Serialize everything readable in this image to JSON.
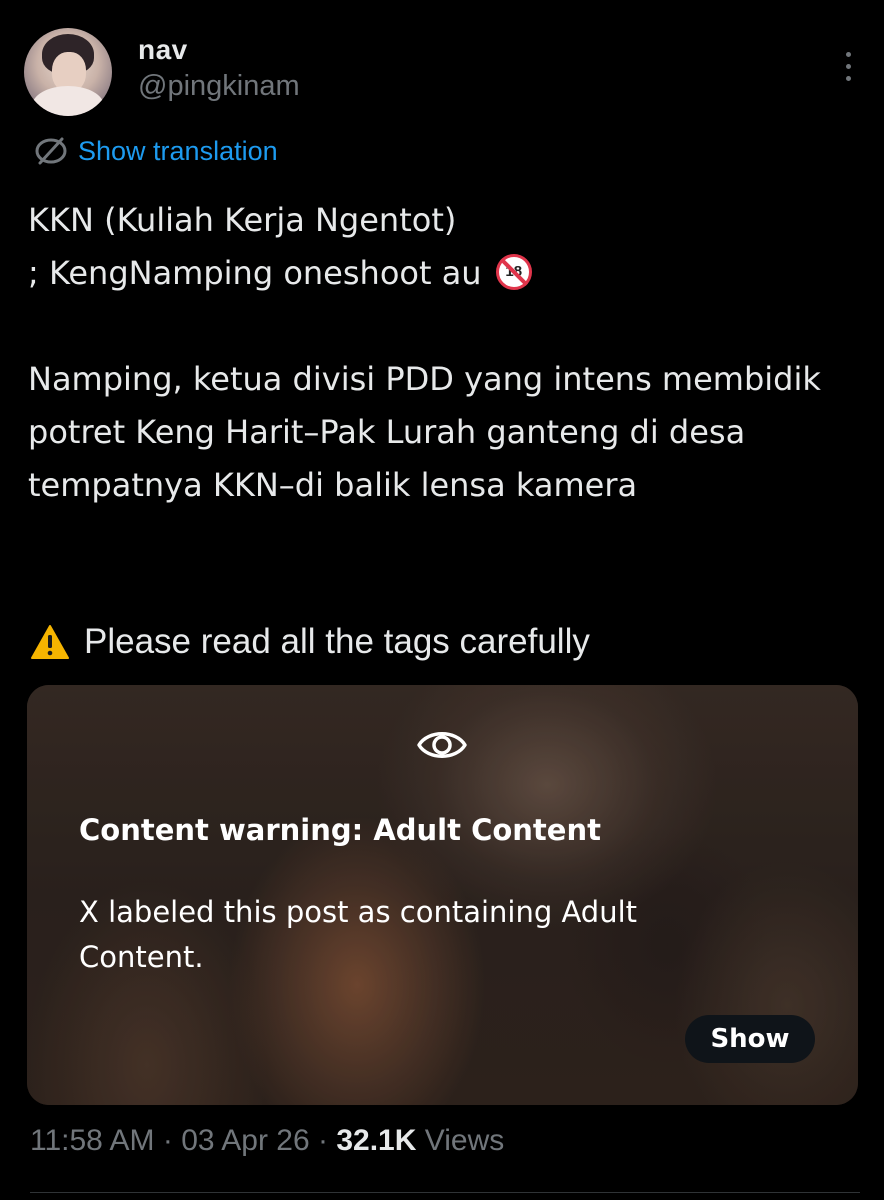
{
  "author": {
    "display_name": "nav",
    "handle": "@pingkinam"
  },
  "icons": {
    "more": "more-vertical-icon",
    "translate": "globe-translate-icon",
    "warning": "warning-sign-emoji",
    "no_under_18": "no-one-under-18-emoji",
    "eye": "eye-icon"
  },
  "translation": {
    "label": "Show translation"
  },
  "tweet": {
    "line1": "KKN (Kuliah Kerja Ngentot)",
    "line2": "; KengNamping oneshoot au",
    "badge_text": "18",
    "paragraph": "Namping, ketua divisi PDD yang intens membidik potret Keng Harit–Pak Lurah ganteng di desa tempatnya KKN–di balik lensa kamera",
    "warning_line": "Please read all the tags carefully"
  },
  "content_warning": {
    "title": "Content warning: Adult Content",
    "body": "X labeled this post as containing Adult Content.",
    "show_button": "Show"
  },
  "meta": {
    "time": "11:58 AM",
    "separator": "·",
    "date": "03 Apr 26",
    "views_count": "32.1K",
    "views_label": "Views"
  },
  "colors": {
    "background": "#000000",
    "text_primary": "#e7e9ea",
    "text_secondary": "#71767b",
    "link": "#1d9bf0",
    "divider": "#2f3336"
  }
}
